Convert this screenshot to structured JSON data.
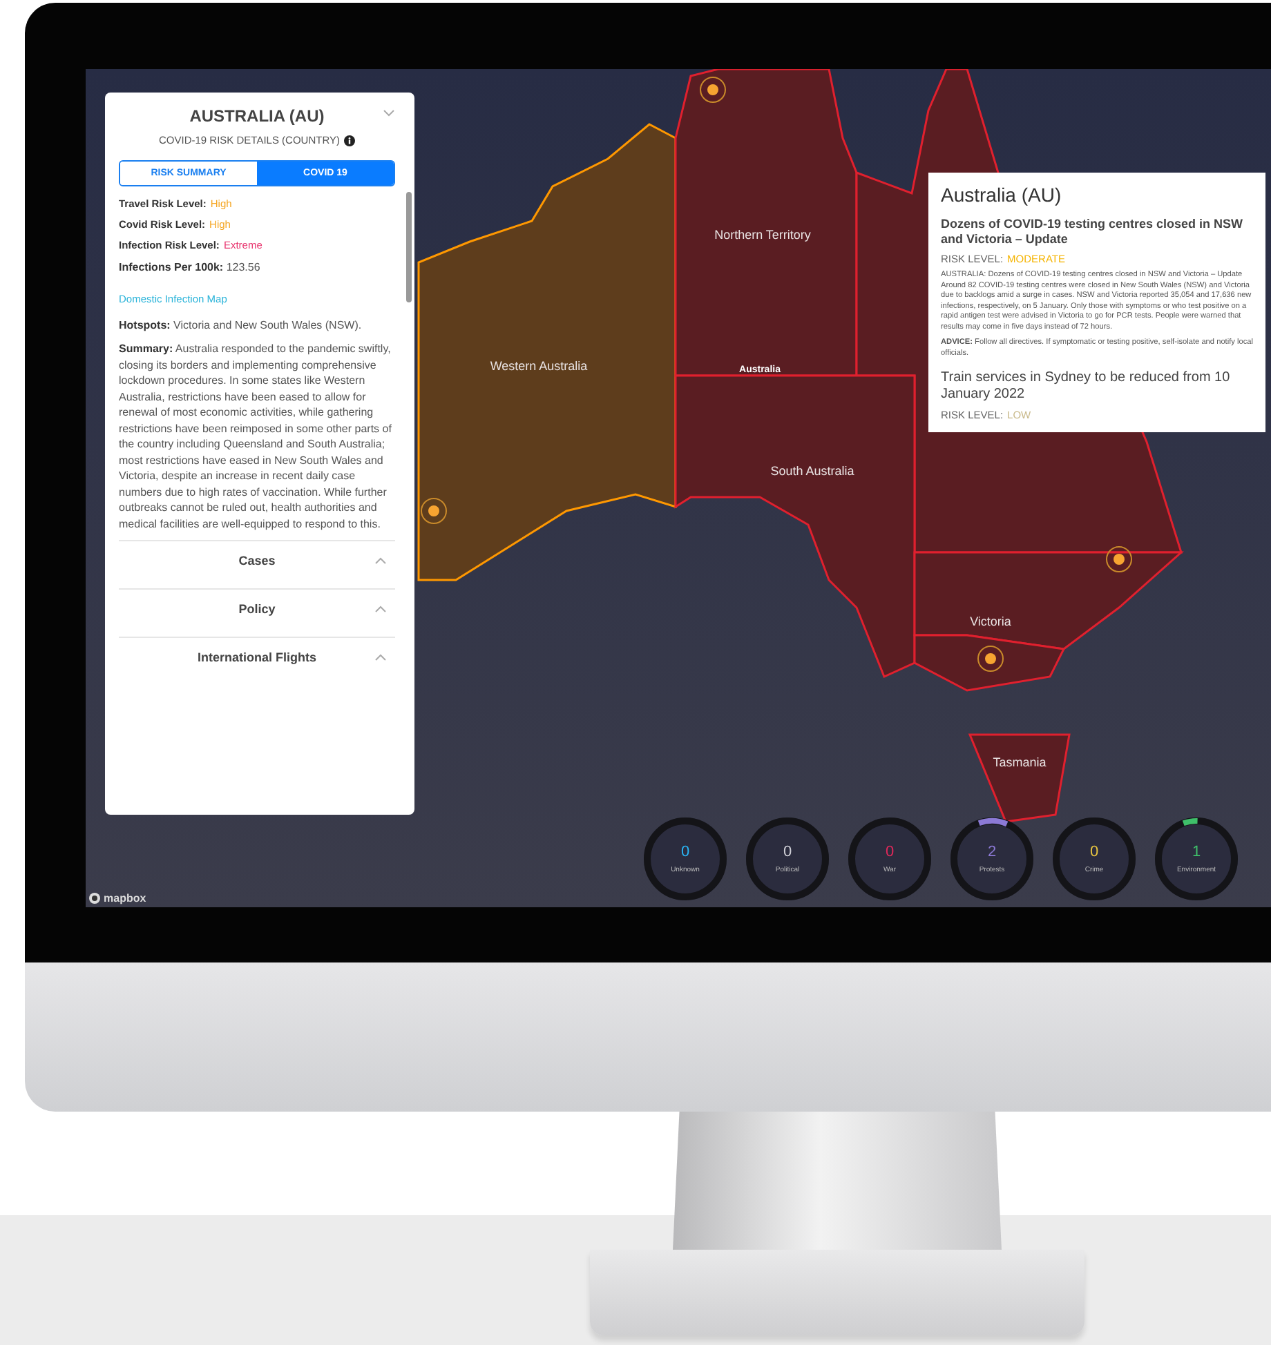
{
  "sidebar": {
    "title": "AUSTRALIA (AU)",
    "subtitle": "COVID-19 RISK DETAILS (COUNTRY)",
    "tabs": [
      {
        "label": "RISK SUMMARY",
        "selected": false
      },
      {
        "label": "COVID 19",
        "selected": true
      }
    ],
    "risk_fields": [
      {
        "label": "Travel Risk Level:",
        "value": "High",
        "color": "#f5a623"
      },
      {
        "label": "Covid Risk Level:",
        "value": "High",
        "color": "#f5a623"
      },
      {
        "label": "Infection Risk Level:",
        "value": "Extreme",
        "color": "#e8336d"
      }
    ],
    "infections": "**Infections Per 100k:** 123.56",
    "link": "Domestic Infection Map",
    "hotspots": "**Hotspots:** Victoria and New South Wales (NSW).",
    "summary": "**Summary:** Australia responded to the pandemic swiftly, closing its borders and implementing comprehensive lockdown procedures. In some states like Western Australia, restrictions have been eased to allow for renewal of most economic activities, while gathering restrictions have been reimposed in some other parts of the country including Queensland and South Australia; most restrictions have eased in New South Wales and Victoria, despite an increase in recent daily case numbers due to high rates of vaccination. While further outbreaks cannot be ruled out, health authorities and medical facilities are well-equipped to respond to this.",
    "sections": [
      "Cases",
      "Policy",
      "International Flights"
    ]
  },
  "map": {
    "country_label": "Australia",
    "attribution": "mapbox",
    "regions": [
      {
        "label": "Western Australia",
        "color": "#ff9800"
      },
      {
        "label": "Northern Territory",
        "color": "#e0202e"
      },
      {
        "color": "#e0202e"
      },
      {
        "label": "South Australia",
        "color": "#e0202e"
      },
      {
        "color": "#e0202e"
      },
      {
        "label": "Victoria",
        "color": "#e0202e"
      },
      {
        "label": "Tasmania",
        "color": "#e0202e"
      }
    ]
  },
  "popup": {
    "title": "Australia (AU)",
    "alerts": [
      {
        "headline": "Dozens of COVID-19 testing centres closed in NSW and Victoria – Update",
        "risk_label": "RISK LEVEL:",
        "risk": "MODERATE",
        "color": "#f5b400",
        "body": "AUSTRALIA: Dozens of COVID-19 testing centres closed in NSW and Victoria – Update Around 82 COVID-19 testing centres were closed in New South Wales (NSW) and Victoria due to backlogs amid a surge in cases. NSW and Victoria reported 35,054 and 17,636 new infections, respectively, on 5 January. Only those with symptoms or who test positive on a rapid antigen test were advised in Victoria to go for PCR tests. People were warned that results may come in five days instead of 72 hours.",
        "advice": "**ADVICE:** Follow all directives. If symptomatic or testing positive, self-isolate and notify local officials."
      },
      {
        "headline": "Train services in Sydney to be reduced from 10 January 2022",
        "risk_label": "RISK LEVEL:",
        "risk": "LOW",
        "color": "#c9b98a"
      }
    ]
  },
  "event_counters": [
    {
      "count": "0",
      "label": "Unknown",
      "color": "#29b6f6",
      "level": 0
    },
    {
      "count": "0",
      "label": "Political",
      "color": "#cfcfd6",
      "level": 0
    },
    {
      "count": "0",
      "label": "War",
      "color": "#e0285a",
      "level": 0
    },
    {
      "count": "2",
      "label": "Protests",
      "color": "#8c7ad6",
      "level": 0.12
    },
    {
      "count": "0",
      "label": "Crime",
      "color": "#e8c640",
      "level": 0
    },
    {
      "count": "1",
      "label": "Environment",
      "color": "#3fbf6a",
      "level": 0.06
    }
  ]
}
